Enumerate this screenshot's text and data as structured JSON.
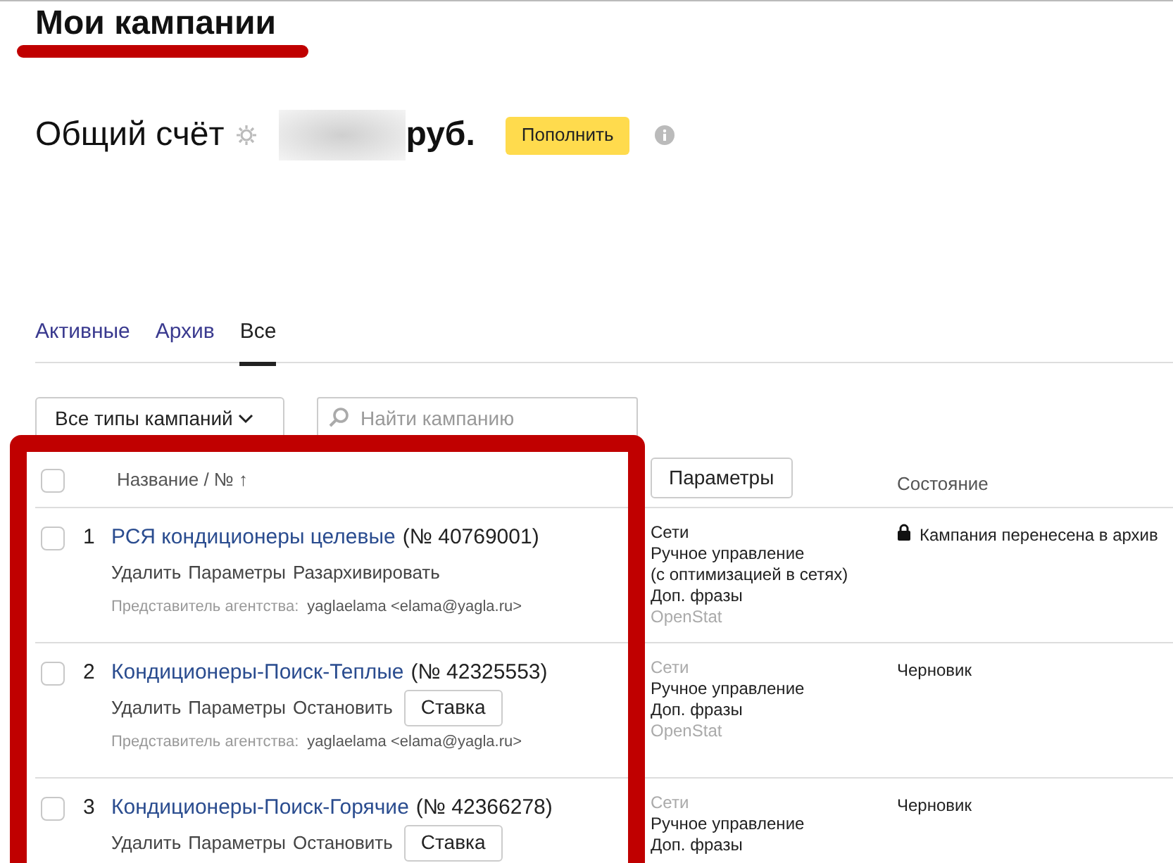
{
  "title": "Мои кампании",
  "account": {
    "label": "Общий счёт",
    "currency": "руб.",
    "button": "Пополнить"
  },
  "tabs": [
    {
      "label": "Активные",
      "selected": false
    },
    {
      "label": "Архив",
      "selected": false
    },
    {
      "label": "Все",
      "selected": true
    }
  ],
  "filter": {
    "label": "Все типы кампаний"
  },
  "search": {
    "placeholder": "Найти кампанию"
  },
  "table": {
    "all_checked": false,
    "columns": [
      {
        "label": "Название / № ↑",
        "kind": "text"
      },
      {
        "label": "Параметры",
        "kind": "button"
      },
      {
        "label": "Состояние",
        "kind": "text"
      }
    ],
    "rows": [
      {
        "index": "1",
        "checked": false,
        "name": "РСЯ кондиционеры целевые",
        "number": "(№ 40769001)",
        "actions": [
          "Удалить",
          "Параметры",
          "Разархивировать"
        ],
        "bid_button": null,
        "agent_label": "Представитель агентства:",
        "agent": "yaglaelama <elama@yagla.ru>",
        "params": [
          {
            "text": "Сети",
            "muted": false
          },
          {
            "text": "Ручное управление",
            "muted": false
          },
          {
            "text": "(с оптимизацией в сетях)",
            "muted": false
          },
          {
            "text": "Доп. фразы",
            "muted": false
          },
          {
            "text": "OpenStat",
            "muted": true
          }
        ],
        "status": "Кампания перенесена в архив",
        "locked": true
      },
      {
        "index": "2",
        "checked": false,
        "name": "Кондиционеры-Поиск-Теплые",
        "number": "(№ 42325553)",
        "actions": [
          "Удалить",
          "Параметры",
          "Остановить"
        ],
        "bid_button": "Ставка",
        "agent_label": "Представитель агентства:",
        "agent": "yaglaelama <elama@yagla.ru>",
        "params": [
          {
            "text": "Сети",
            "muted": true
          },
          {
            "text": "Ручное управление",
            "muted": false
          },
          {
            "text": "Доп. фразы",
            "muted": false
          },
          {
            "text": "OpenStat",
            "muted": true
          }
        ],
        "status": "Черновик",
        "locked": false
      },
      {
        "index": "3",
        "checked": false,
        "name": "Кондиционеры-Поиск-Горячие",
        "number": "(№ 42366278)",
        "actions": [
          "Удалить",
          "Параметры",
          "Остановить"
        ],
        "bid_button": "Ставка",
        "params": [
          {
            "text": "Сети",
            "muted": true
          },
          {
            "text": "Ручное управление",
            "muted": false
          },
          {
            "text": "Доп. фразы",
            "muted": false
          }
        ],
        "status": "Черновик",
        "locked": false
      }
    ]
  }
}
